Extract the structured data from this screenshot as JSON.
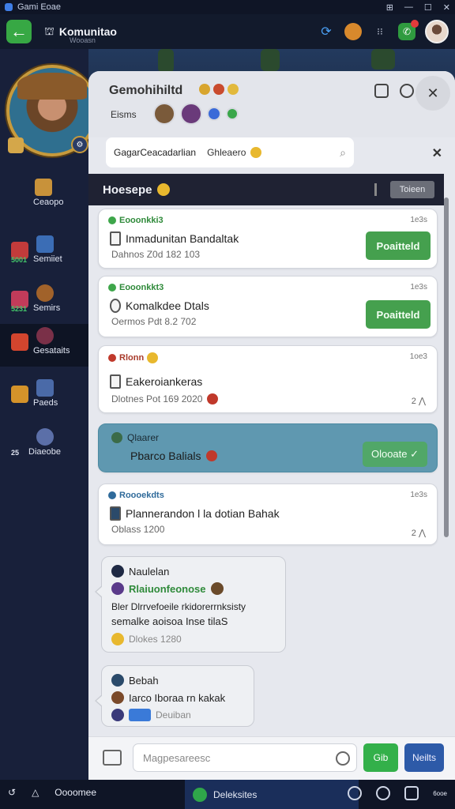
{
  "os": {
    "title": "Gami Eoae",
    "controls": [
      "⊞",
      "—",
      "☐",
      "✕"
    ]
  },
  "header": {
    "back_label": "←",
    "title": "Komunitao",
    "subtitle": "Wooasn",
    "menu_dots": "⁝⁝"
  },
  "rail": {
    "items": [
      {
        "label": "Ceaopo",
        "count": ""
      },
      {
        "label": "Semiiet",
        "count": "5001"
      },
      {
        "label": "Semirs",
        "count": "5231"
      },
      {
        "label": "Gesataits",
        "count": ""
      },
      {
        "label": "Paeds",
        "count": ""
      },
      {
        "label": "Diaeobe",
        "count": "25"
      }
    ]
  },
  "panel": {
    "title": "Gemohihiltd",
    "sub": "Eisms",
    "close_label": "✕",
    "search": {
      "text": "GagarCeacadarlian",
      "tag": "Ghleaero",
      "icon": "search-icon"
    },
    "search_close": "✕",
    "section": {
      "title": "Hoesepe",
      "button": "Toieen"
    }
  },
  "cards": [
    {
      "tag": "Eooonkki3",
      "time": "1e3s",
      "main": "Inmadunitan Bandaltak",
      "meta": "Dahnos Z0d 182 103",
      "action": "Poaitteld"
    },
    {
      "tag": "Eooonkkt3",
      "time": "1e3s",
      "main": "Komalkdee Dtals",
      "meta": "Oermos Pdt 8.2 702",
      "action": "Poaitteld"
    },
    {
      "tag": "Rlonn",
      "time": "1oe3",
      "main": "Eakeroiankeras",
      "meta": "Dlotnes Pot 169 2020",
      "reply": "2 ⋀"
    },
    {
      "tag": "Qlaarer",
      "main": "Pbarco Balials",
      "action": "Olooate ✓"
    },
    {
      "tag": "Roooekdts",
      "time": "1e3s",
      "main": "Plannerandon l la dotian Bahak",
      "meta": "Oblass 1200",
      "reply": "2 ⋀"
    }
  ],
  "bubbles": [
    {
      "name": "Naulelan",
      "handle": "Rlaiuonfeonose",
      "text1": "Bler Dlrrvefoeile rkidorerrnksisty",
      "text2": "semalke aoisoa Inse tilaS",
      "meta": "Dlokes 1280"
    },
    {
      "name": "Bebah",
      "text1": "Iarco Iboraa rn kakak",
      "meta": "Deuiban"
    }
  ],
  "composer": {
    "placeholder": "Magpesareesc",
    "gif": "Gib",
    "send": "Neilts"
  },
  "bottom": {
    "home_label": "Oooomee",
    "center_label": "Deleksites",
    "right_label": "6ooe"
  }
}
